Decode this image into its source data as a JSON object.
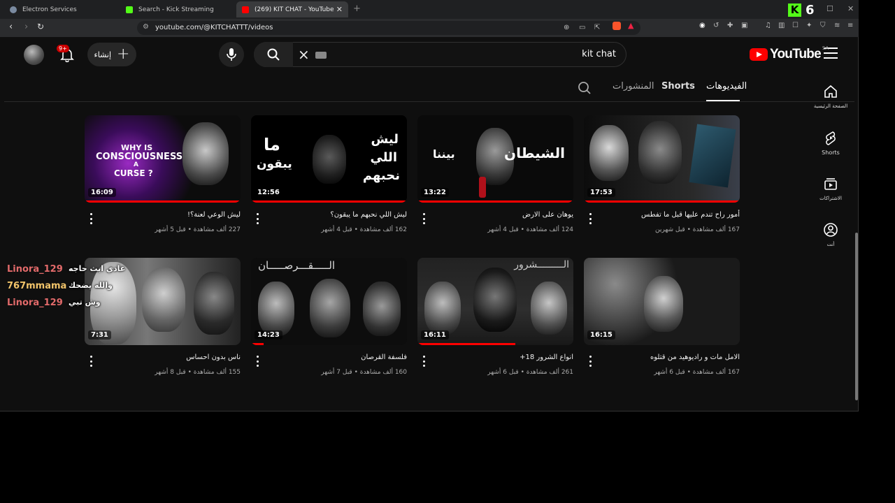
{
  "browser": {
    "tabs": [
      {
        "title": "Electron Services",
        "color": "#7a8aa0"
      },
      {
        "title": "Search - Kick Streaming",
        "color": "#53fc18"
      },
      {
        "title": "(269) KIT CHAT - YouTube",
        "color": "#ff0000"
      }
    ],
    "kick_count": "6",
    "url": "youtube.com/@KITCHATTT/videos"
  },
  "header": {
    "logo_text": "YouTube",
    "country_code": "SA",
    "search_query": "kit chat",
    "create_label": "إنشاء",
    "notification_badge": "9+"
  },
  "channel_tabs": [
    {
      "label": "الفيديوهات",
      "active": true
    },
    {
      "label": "Shorts",
      "active": false
    },
    {
      "label": "المنشورات",
      "active": false
    }
  ],
  "sidebar": {
    "items": [
      {
        "label": "الصفحة الرئيسية",
        "icon": "home-icon"
      },
      {
        "label": "Shorts",
        "icon": "shorts-icon"
      },
      {
        "label": "الاشتراكات",
        "icon": "subscriptions-icon"
      },
      {
        "label": "أنت",
        "icon": "you-icon"
      }
    ]
  },
  "videos": [
    {
      "title": "أمور راح تندم عليها قبل ما تفطس",
      "meta": "167 ألف مشاهدة • قبل شهرين",
      "duration": "17:53",
      "progress": 1.0
    },
    {
      "title": "يوهان على الارض",
      "meta": "124 ألف مشاهدة • قبل 4 أشهر",
      "duration": "13:22",
      "progress": 1.0,
      "thumb_text": [
        "الشيطان",
        "بيننا"
      ]
    },
    {
      "title": "ليش اللي نحبهم ما يبقون؟",
      "meta": "162 ألف مشاهدة • قبل 4 أشهر",
      "duration": "12:56",
      "progress": 1.0,
      "thumb_text": [
        "ليش",
        "اللي",
        "نحبهم",
        "ما",
        "يبقون"
      ]
    },
    {
      "title": "ليش الوعي لعنة؟!",
      "meta": "227 ألف مشاهدة • قبل 5 أشهر",
      "duration": "16:09",
      "progress": 1.0,
      "thumb_text": [
        "WHY IS",
        "CONSCIOUSNESS",
        "A",
        "CURSE ?"
      ]
    },
    {
      "title": "الامل مات و راديوهيد من قتلوه",
      "meta": "167 ألف مشاهدة • قبل 6 أشهر",
      "duration": "16:15",
      "progress": 0.0
    },
    {
      "title": "انواع الشرور 18+",
      "meta": "261 ألف مشاهدة • قبل 6 أشهر",
      "duration": "16:11",
      "progress": 0.63,
      "thumb_text": [
        "الـــــــــشرور"
      ]
    },
    {
      "title": "فلسفة القرصان",
      "meta": "160 ألف مشاهدة • قبل 7 أشهر",
      "duration": "14:23",
      "progress": 0.08,
      "thumb_text": [
        "الـــــقـــرصـــــان"
      ]
    },
    {
      "title": "ناس بدون احساس",
      "meta": "155 ألف مشاهدة • قبل 8 أشهر",
      "duration": "7:31",
      "progress": 0.0
    }
  ],
  "chat_overlay": [
    {
      "user": "Linora_129",
      "message": "عادي ابث حاجه",
      "color": "#e26a6a"
    },
    {
      "user": "767mmama",
      "message": "والله يضحك",
      "color": "#f2c46a"
    },
    {
      "user": "Linora_129",
      "message": "وش تبي",
      "color": "#e26a6a"
    }
  ]
}
